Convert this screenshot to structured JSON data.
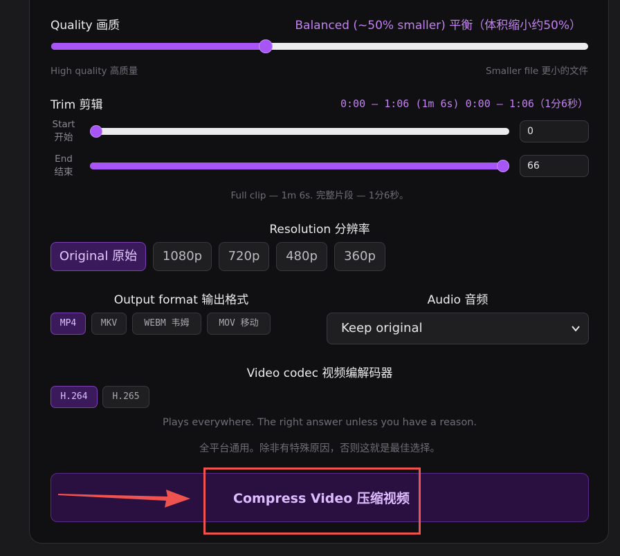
{
  "quality": {
    "label": "Quality 画质",
    "value_label": "Balanced (~50% smaller) 平衡（体积缩小约50%）",
    "level": 0.4,
    "min_hint": "High quality 高质量",
    "max_hint": "Smaller file 更小的文件"
  },
  "trim": {
    "label": "Trim 剪辑",
    "range_label": "0:00 – 1:06 (1m 6s) 0:00 – 1:06（1分6秒）",
    "start": {
      "label_en": "Start",
      "label_zh": "开始",
      "value": "0",
      "max": 66
    },
    "end": {
      "label_en": "End",
      "label_zh": "结束",
      "value": "66",
      "max": 66
    },
    "hint": "Full clip — 1m 6s. 完整片段 — 1分6秒。"
  },
  "resolution": {
    "label": "Resolution 分辨率",
    "options": [
      "Original 原始",
      "1080p",
      "720p",
      "480p",
      "360p"
    ],
    "selected": "Original 原始"
  },
  "output_format": {
    "label": "Output format 输出格式",
    "options": [
      "MP4",
      "MKV",
      "WEBM 韦姆",
      "MOV 移动"
    ],
    "selected": "MP4"
  },
  "audio": {
    "label": "Audio 音频",
    "selected": "Keep original"
  },
  "codec": {
    "label": "Video codec 视频编解码器",
    "options": [
      "H.264",
      "H.265"
    ],
    "selected": "H.264",
    "hint_en": "Plays everywhere. The right answer unless you have a reason.",
    "hint_zh": "全平台通用。除非有特殊原因，否则这就是最佳选择。"
  },
  "compress_button": {
    "label": "Compress Video 压缩视频"
  },
  "colors": {
    "accent": "#a855f7",
    "annotation": "#ef5350"
  },
  "icons": {
    "select_chevron": "chevron-down-icon",
    "annotation_arrow": "arrow-right-icon"
  }
}
